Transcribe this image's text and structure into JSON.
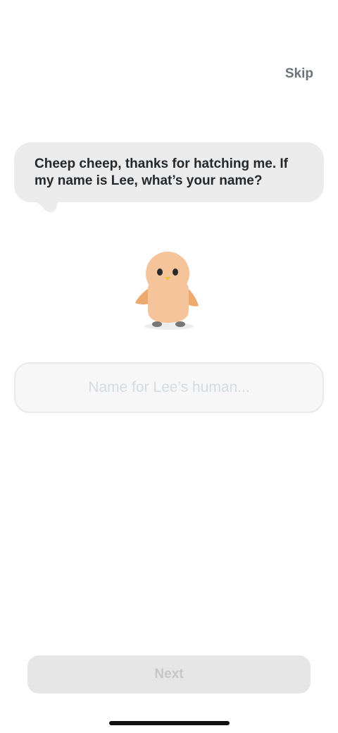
{
  "header": {
    "skip_label": "Skip"
  },
  "speech_bubble": {
    "text": "Cheep cheep, thanks for hatching me. If my name is Lee, what’s your name?"
  },
  "mascot": {
    "icon": "chick-mascot-icon",
    "body_color": "#f5c49a",
    "wing_color": "#eea96f",
    "beak_color": "#f2c230"
  },
  "name_input": {
    "value": "",
    "placeholder": "Name for Lee’s human..."
  },
  "footer": {
    "next_label": "Next",
    "next_enabled": false
  },
  "colors": {
    "bubble_bg": "#ececec",
    "button_disabled_bg": "#e6e6e6",
    "button_disabled_text": "#c7c7c7",
    "skip_text": "#6b7378"
  }
}
